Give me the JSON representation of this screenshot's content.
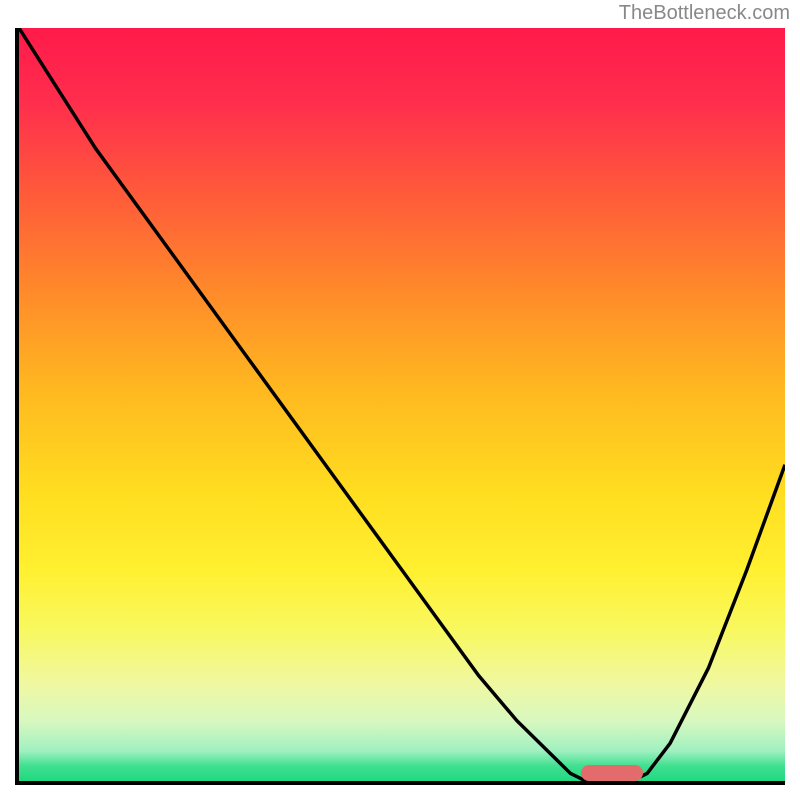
{
  "watermark": "TheBottleneck.com",
  "chart_data": {
    "type": "line",
    "x": [
      0,
      5,
      10,
      15,
      20,
      25,
      30,
      35,
      40,
      45,
      50,
      55,
      60,
      65,
      70,
      72,
      74,
      76,
      78,
      80,
      82,
      85,
      90,
      95,
      100
    ],
    "values": [
      100,
      92,
      84,
      77,
      70,
      63,
      56,
      49,
      42,
      35,
      28,
      21,
      14,
      8,
      3,
      1,
      0,
      0,
      0,
      0,
      1,
      5,
      15,
      28,
      42
    ],
    "title": "",
    "xlabel": "",
    "ylabel": "",
    "xlim": [
      0,
      100
    ],
    "ylim": [
      0,
      100
    ],
    "marker": {
      "x_start": 73,
      "x_end": 81,
      "y": 0
    }
  },
  "colors": {
    "curve": "#000000",
    "marker": "#e36b6b",
    "watermark": "#888888"
  }
}
